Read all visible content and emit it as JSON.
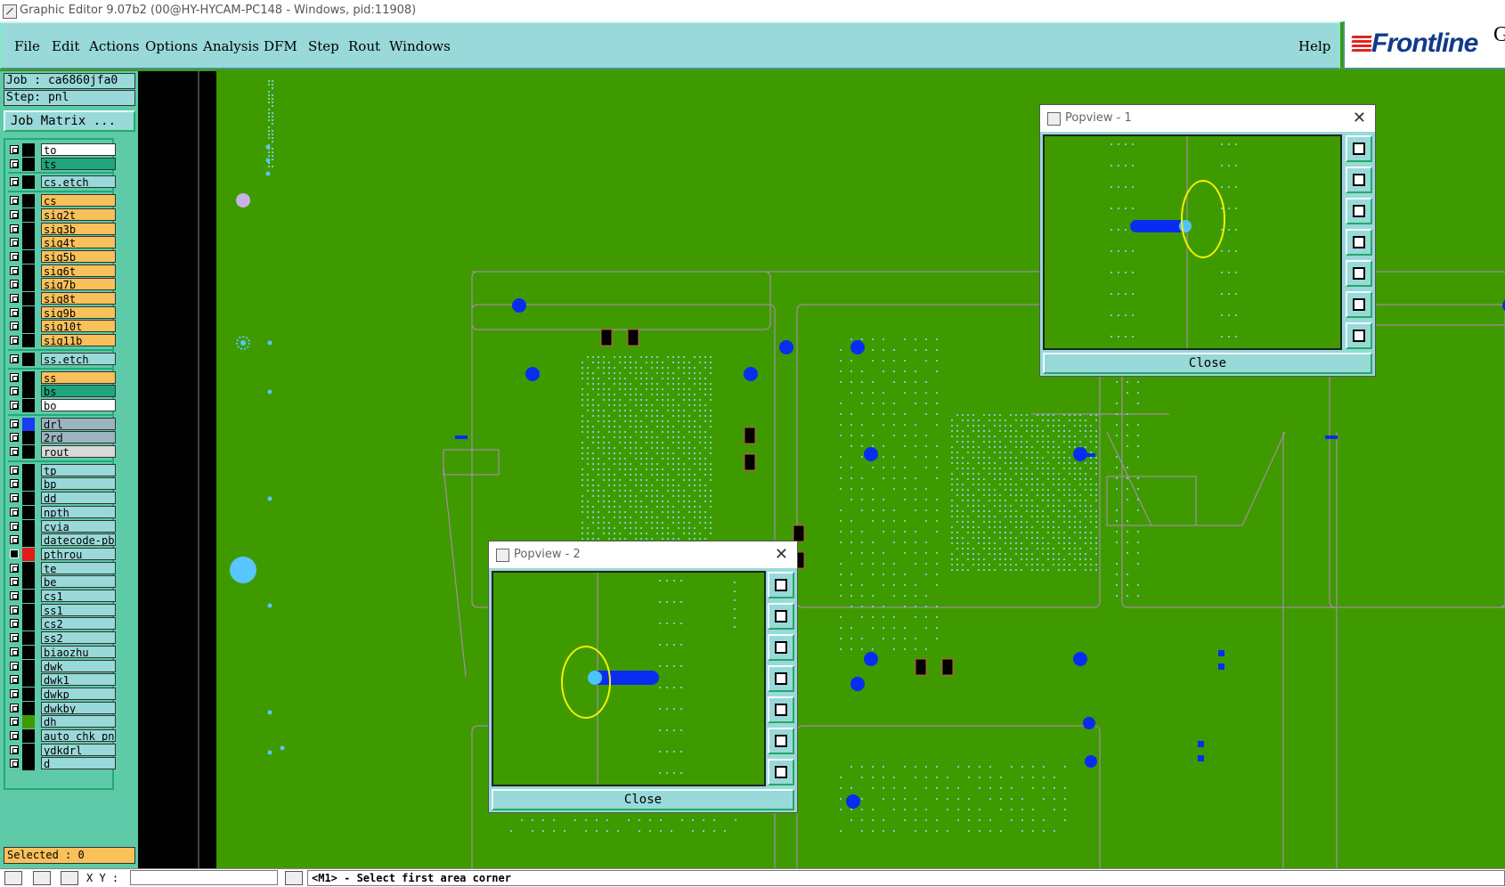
{
  "titlebar": {
    "title": "Graphic Editor 9.07b2 (00@HY-HYCAM-PC148 - Windows, pid:11908)"
  },
  "menubar": {
    "items": [
      "File",
      "Edit",
      "Actions",
      "Options",
      "Analysis",
      "DFM",
      "Step",
      "Rout",
      "Windows"
    ],
    "help": "Help"
  },
  "logo": {
    "brand": "Frontline",
    "extra": "G"
  },
  "job": {
    "job_label": "Job : ca6860jfa0",
    "step_label": "Step: pnl",
    "job_matrix": "Job Matrix ..."
  },
  "layers": [
    {
      "name": "to",
      "color": "#ffffff",
      "swatch": "#000000",
      "checked": false
    },
    {
      "name": "ts",
      "color": "#1fa57c",
      "swatch": "#000000",
      "checked": false
    },
    {
      "name": "cs.etch",
      "color": "#99d9d9",
      "swatch": "#000000",
      "checked": false
    },
    {
      "name": "cs",
      "color": "#f9c15a",
      "swatch": "#000000",
      "checked": false
    },
    {
      "name": "sig2t",
      "color": "#f9c15a",
      "swatch": "#000000",
      "checked": false
    },
    {
      "name": "sig3b",
      "color": "#f9c15a",
      "swatch": "#000000",
      "checked": false
    },
    {
      "name": "sig4t",
      "color": "#f9c15a",
      "swatch": "#000000",
      "checked": false
    },
    {
      "name": "sig5b",
      "color": "#f9c15a",
      "swatch": "#000000",
      "checked": false
    },
    {
      "name": "sig6t",
      "color": "#f9c15a",
      "swatch": "#000000",
      "checked": false
    },
    {
      "name": "sig7b",
      "color": "#f9c15a",
      "swatch": "#000000",
      "checked": false
    },
    {
      "name": "sig8t",
      "color": "#f9c15a",
      "swatch": "#000000",
      "checked": false
    },
    {
      "name": "sig9b",
      "color": "#f9c15a",
      "swatch": "#000000",
      "checked": false
    },
    {
      "name": "sig10t",
      "color": "#f9c15a",
      "swatch": "#000000",
      "checked": false
    },
    {
      "name": "sig11b",
      "color": "#f9c15a",
      "swatch": "#000000",
      "checked": false
    },
    {
      "name": "ss.etch",
      "color": "#99d9d9",
      "swatch": "#000000",
      "checked": false
    },
    {
      "name": "ss",
      "color": "#f9c15a",
      "swatch": "#000000",
      "checked": false
    },
    {
      "name": "bs",
      "color": "#1fa57c",
      "swatch": "#000000",
      "checked": false
    },
    {
      "name": "bo",
      "color": "#ffffff",
      "swatch": "#000000",
      "checked": false
    },
    {
      "name": "drl",
      "color": "#9bb5bf",
      "swatch": "#1b3bf0",
      "checked": false
    },
    {
      "name": "2rd",
      "color": "#9bb5bf",
      "swatch": "#000000",
      "checked": false
    },
    {
      "name": "rout",
      "color": "#d9d9d9",
      "swatch": "#000000",
      "checked": false
    },
    {
      "name": "tp",
      "color": "#99d9d9",
      "swatch": "#000000",
      "checked": false
    },
    {
      "name": "bp",
      "color": "#99d9d9",
      "swatch": "#000000",
      "checked": false
    },
    {
      "name": "dd",
      "color": "#99d9d9",
      "swatch": "#000000",
      "checked": false
    },
    {
      "name": "npth",
      "color": "#99d9d9",
      "swatch": "#000000",
      "checked": false
    },
    {
      "name": "cvia",
      "color": "#99d9d9",
      "swatch": "#000000",
      "checked": false
    },
    {
      "name": "datecode-pbo",
      "color": "#99d9d9",
      "swatch": "#000000",
      "checked": false
    },
    {
      "name": "pthrou",
      "color": "#99d9d9",
      "swatch": "#e21a1a",
      "checked": true
    },
    {
      "name": "te",
      "color": "#99d9d9",
      "swatch": "#000000",
      "checked": false
    },
    {
      "name": "be",
      "color": "#99d9d9",
      "swatch": "#000000",
      "checked": false
    },
    {
      "name": "cs1",
      "color": "#99d9d9",
      "swatch": "#000000",
      "checked": false
    },
    {
      "name": "ss1",
      "color": "#99d9d9",
      "swatch": "#000000",
      "checked": false
    },
    {
      "name": "cs2",
      "color": "#99d9d9",
      "swatch": "#000000",
      "checked": false
    },
    {
      "name": "ss2",
      "color": "#99d9d9",
      "swatch": "#000000",
      "checked": false
    },
    {
      "name": "biaozhu",
      "color": "#99d9d9",
      "swatch": "#000000",
      "checked": false
    },
    {
      "name": "dwk",
      "color": "#99d9d9",
      "swatch": "#000000",
      "checked": false
    },
    {
      "name": "dwk1",
      "color": "#99d9d9",
      "swatch": "#000000",
      "checked": false
    },
    {
      "name": "dwkp",
      "color": "#99d9d9",
      "swatch": "#000000",
      "checked": false
    },
    {
      "name": "dwkby",
      "color": "#99d9d9",
      "swatch": "#000000",
      "checked": false
    },
    {
      "name": "dh",
      "color": "#99d9d9",
      "swatch": "#3f9a00",
      "checked": false
    },
    {
      "name": "auto_chk_pnl",
      "color": "#99d9d9",
      "swatch": "#000000",
      "checked": false
    },
    {
      "name": "ydkdrl",
      "color": "#99d9d9",
      "swatch": "#000000",
      "checked": false
    },
    {
      "name": "d",
      "color": "#99d9d9",
      "swatch": "#000000",
      "checked": false
    }
  ],
  "selected": "Selected : 0",
  "status": {
    "xy_label": "X Y :",
    "message": "<M1> - Select first area corner"
  },
  "popview1": {
    "title": "Popview - 1",
    "close": "Close"
  },
  "popview2": {
    "title": "Popview - 2",
    "close": "Close"
  },
  "colors": {
    "board": "#3f9a00",
    "panel": "#99d9d9",
    "pad": "#0a2cf0",
    "pad_highlight": "#4fc3ff",
    "outline": "#b889c8",
    "marker": "#f5f000"
  }
}
